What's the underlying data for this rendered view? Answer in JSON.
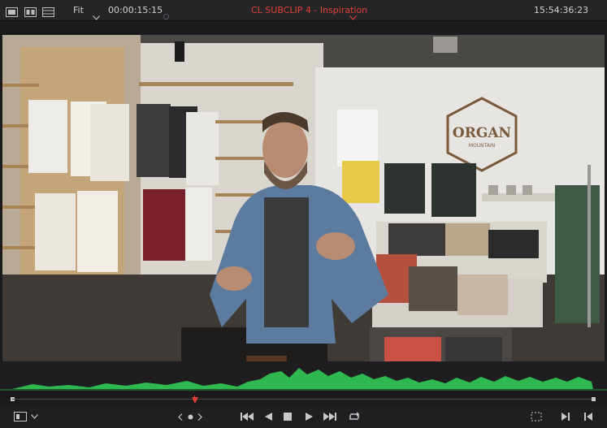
{
  "toolbar": {
    "fit_label": "Fit",
    "source_timecode": "00:00:15:15",
    "clip_title": "CL SUBCLIP 4 - Inspiration",
    "record_timecode": "15:54:36:23"
  },
  "scene": {
    "sign_main": "ORGAN",
    "sign_sub": "MOUNTAIN"
  },
  "colors": {
    "accent_red": "#e0403a",
    "waveform_green": "#2fb84f",
    "background": "#1b1b1d"
  },
  "playhead_position": 0.31
}
